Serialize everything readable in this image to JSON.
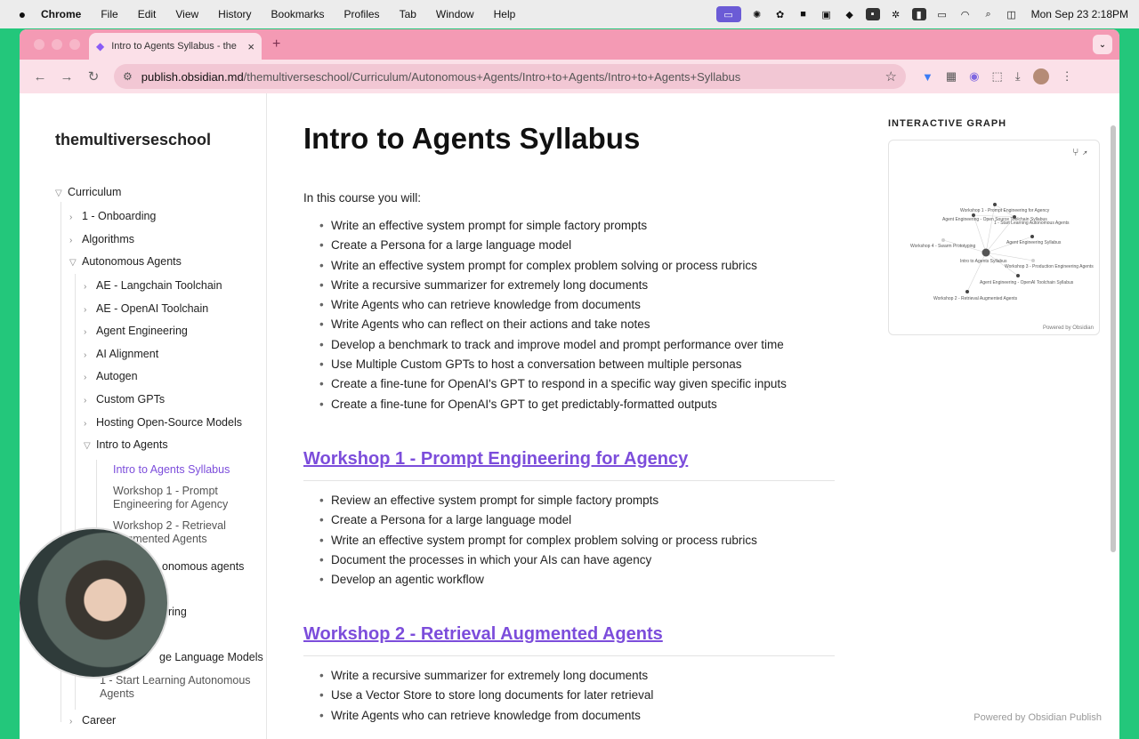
{
  "menubar": {
    "apple": "",
    "app": "Chrome",
    "items": [
      "File",
      "Edit",
      "View",
      "History",
      "Bookmarks",
      "Profiles",
      "Tab",
      "Window",
      "Help"
    ],
    "clock": "Mon Sep 23  2:18PM"
  },
  "browser": {
    "tab_title": "Intro to Agents Syllabus - the",
    "url_host": "publish.obsidian.md",
    "url_path": "/themultiverseschool/Curriculum/Autonomous+Agents/Intro+to+Agents/Intro+to+Agents+Syllabus"
  },
  "sidebar": {
    "site_title": "themultiverseschool",
    "items": [
      {
        "label": "Curriculum",
        "chev": "▽"
      },
      {
        "label": "1 - Onboarding",
        "chev": "›"
      },
      {
        "label": "Algorithms",
        "chev": "›"
      },
      {
        "label": "Autonomous Agents",
        "chev": "▽"
      },
      {
        "label": "AE - Langchain Toolchain",
        "chev": "›"
      },
      {
        "label": "AE - OpenAI Toolchain",
        "chev": "›"
      },
      {
        "label": "Agent Engineering",
        "chev": "›"
      },
      {
        "label": "AI Alignment",
        "chev": "›"
      },
      {
        "label": "Autogen",
        "chev": "›"
      },
      {
        "label": "Custom GPTs",
        "chev": "›"
      },
      {
        "label": "Hosting Open-Source Models",
        "chev": "›"
      },
      {
        "label": "Intro to Agents",
        "chev": "▽"
      },
      {
        "label": "Intro to Agents Syllabus"
      },
      {
        "label": "Workshop 1 - Prompt Engineering for Agency"
      },
      {
        "label": "Workshop 2 - Retrieval Augmented Agents"
      },
      {
        "label": "onomous agents"
      },
      {
        "label": "ering"
      },
      {
        "label": "ge Language Models"
      },
      {
        "label": "1 - Start Learning Autonomous Agents"
      },
      {
        "label": "Career",
        "chev": "›"
      }
    ]
  },
  "main": {
    "title": "Intro to Agents Syllabus",
    "intro": "In this course you will:",
    "goals": [
      "Write an effective system prompt for simple factory prompts",
      "Create a Persona for a large language model",
      "Write an effective system prompt for complex problem solving or process rubrics",
      "Write a recursive summarizer for extremely long documents",
      "Write Agents who can retrieve knowledge from documents",
      "Write Agents who can reflect on their actions and take notes",
      "Develop a benchmark to track and improve model and prompt performance over time",
      "Use Multiple Custom GPTs to host a conversation between multiple personas",
      "Create a fine-tune for OpenAI's GPT to respond in a specific way given specific inputs",
      "Create a fine-tune for OpenAI's GPT to get predictably-formatted outputs"
    ],
    "workshop1": {
      "title": "Workshop 1 - Prompt Engineering for Agency",
      "items": [
        "Review an effective system prompt for simple factory prompts",
        "Create a Persona for a large language model",
        "Write an effective system prompt for complex problem solving or process rubrics",
        "Document the processes in which your AIs can have agency",
        "Develop an agentic workflow"
      ]
    },
    "workshop2": {
      "title": "Workshop 2 - Retrieval Augmented Agents",
      "items": [
        "Write a recursive summarizer for extremely long documents",
        "Use a Vector Store to store long documents for later retrieval",
        "Write Agents who can retrieve knowledge from documents"
      ]
    }
  },
  "graph": {
    "title": "INTERACTIVE GRAPH",
    "powered": "Powered by Obsidian",
    "labels": [
      "Workshop 1 - Prompt Engineering for Agency",
      "Agent Engineering - Open Source Toolchain Syllabus",
      "1 - Start Learning Autonomous Agents",
      "Agent Engineering Syllabus",
      "Workshop 4 - Swarm Prototyping",
      "Intro to Agents Syllabus",
      "Workshop 3 - Production Engineering Agents",
      "Agent Engineering - OpenAI Toolchain Syllabus",
      "Workshop 2 - Retrieval Augmented Agents"
    ]
  },
  "footer": "Powered by Obsidian Publish"
}
